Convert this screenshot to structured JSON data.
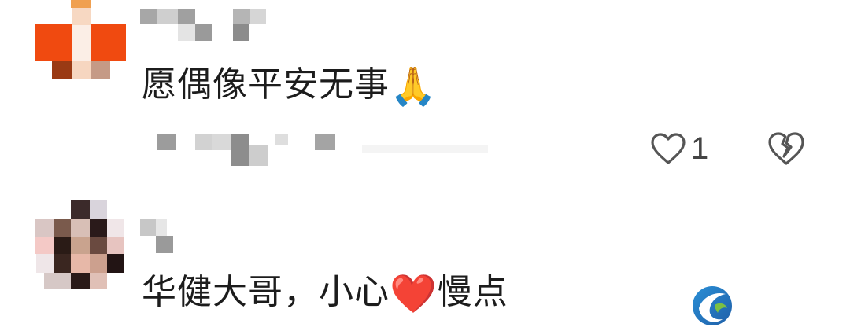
{
  "comments": [
    {
      "text": "愿偶像平安无事",
      "emoji": "🙏",
      "emoji_name": "folded-hands",
      "likes": "1",
      "like_icon": "heart-outline-icon",
      "dislike_icon": "broken-heart-icon"
    },
    {
      "text_before": "华健大哥，小心",
      "emoji": "❤️",
      "emoji_name": "red-heart",
      "text_after": "慢点"
    }
  ],
  "colors": {
    "text": "#1c1c1c",
    "icon": "#555555",
    "avatar1_accent": "#f04a10"
  },
  "watermark_icon": "app-logo-icon"
}
